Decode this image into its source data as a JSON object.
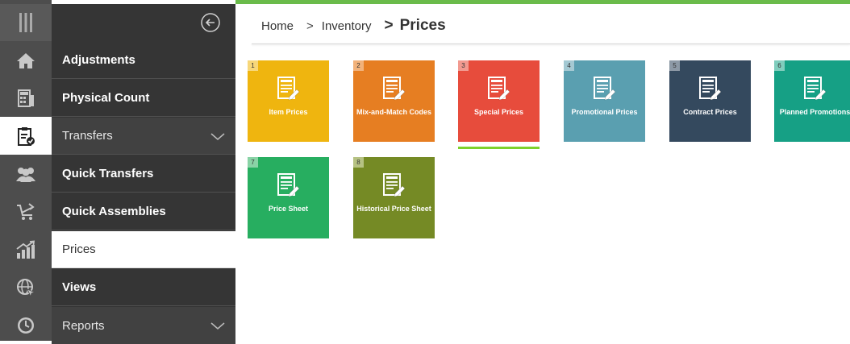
{
  "breadcrumb": {
    "home": "Home",
    "sep1": ">",
    "inventory": "Inventory",
    "sep2": ">",
    "current": "Prices"
  },
  "menu": {
    "items": [
      {
        "label": "Adjustments"
      },
      {
        "label": "Physical Count"
      },
      {
        "label": "Transfers"
      },
      {
        "label": "Quick Transfers"
      },
      {
        "label": "Quick Assemblies"
      },
      {
        "label": "Prices"
      },
      {
        "label": "Views"
      },
      {
        "label": "Reports"
      }
    ]
  },
  "rail_icons": [
    "menu-icon",
    "home-icon",
    "calculator-icon",
    "clipboard-check-icon",
    "users-icon",
    "cart-icon",
    "growth-chart-icon",
    "globe-cursor-icon",
    "clock-icon"
  ],
  "tiles": [
    {
      "num": "1",
      "label": "Item Prices",
      "color": "#efb50f",
      "badge": "#f7d77a"
    },
    {
      "num": "2",
      "label": "Mix-and-Match Codes",
      "color": "#e67e22",
      "badge": "#f2b27a"
    },
    {
      "num": "3",
      "label": "Special Prices",
      "color": "#e74c3c",
      "badge": "#f29a90"
    },
    {
      "num": "4",
      "label": "Promotional Prices",
      "color": "#5a9fb0",
      "badge": "#a4c9d3"
    },
    {
      "num": "5",
      "label": "Contract Prices",
      "color": "#34495e",
      "badge": "#8d99a6"
    },
    {
      "num": "6",
      "label": "Planned Promotions",
      "color": "#16a085",
      "badge": "#7fcdbd"
    },
    {
      "num": "7",
      "label": "Price Sheet",
      "color": "#27ae60",
      "badge": "#89d3a6"
    },
    {
      "num": "8",
      "label": "Historical Price Sheet",
      "color": "#758a25",
      "badge": "#b6c283"
    }
  ],
  "colors": {
    "accent": "#6abb4a",
    "menu_bg": "#353535",
    "rail_bg": "#4d4d4d",
    "selected_underline": "#7ed12c"
  }
}
